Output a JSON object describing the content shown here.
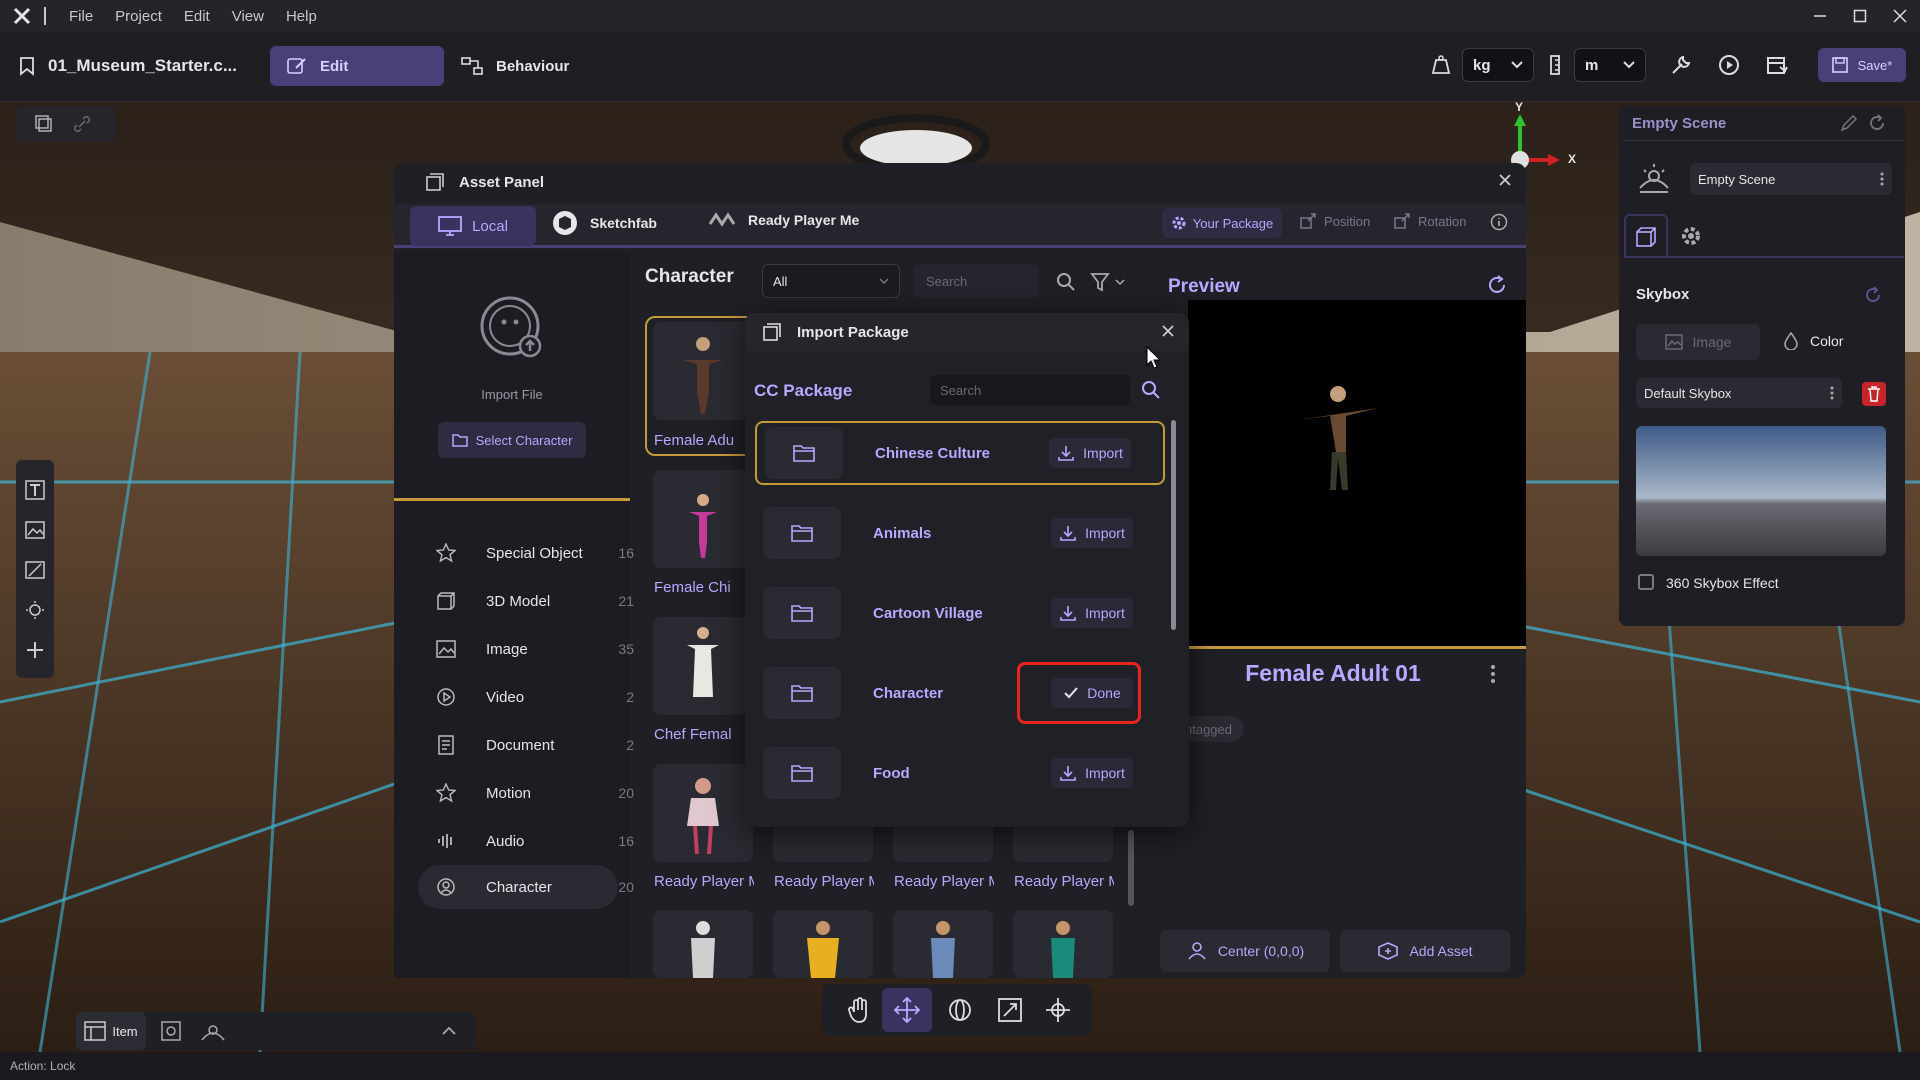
{
  "menubar": {
    "items": [
      "File",
      "Project",
      "Edit",
      "View",
      "Help"
    ]
  },
  "toolbar": {
    "project_name": "01_Museum_Starter.c...",
    "tab_edit": "Edit",
    "tab_behaviour": "Behaviour",
    "unit_mass": "kg",
    "unit_length": "m",
    "save_label": "Save*"
  },
  "asset_panel": {
    "title": "Asset Panel",
    "tabs": [
      "Local",
      "Sketchfab",
      "Ready Player Me"
    ],
    "your_package": "Your Package",
    "position": "Position",
    "rotation": "Rotation",
    "import_file": "Import File",
    "select_character": "Select Character",
    "categories": [
      {
        "label": "Special Object",
        "count": "16"
      },
      {
        "label": "3D Model",
        "count": "21"
      },
      {
        "label": "Image",
        "count": "35"
      },
      {
        "label": "Video",
        "count": "2"
      },
      {
        "label": "Document",
        "count": "2"
      },
      {
        "label": "Motion",
        "count": "20"
      },
      {
        "label": "Audio",
        "count": "16"
      },
      {
        "label": "Character",
        "count": "20"
      }
    ],
    "grid_title": "Character",
    "filter_value": "All",
    "search_placeholder": "Search",
    "thumbs": [
      "Female Adu",
      "Female Chi",
      "Chef Femal",
      "Ready Player M",
      "Ready Player M",
      "Ready Player M",
      "Ready Player M"
    ],
    "preview_title": "Preview",
    "preview_name": "Female Adult 01",
    "preview_tag": "Untagged",
    "center_label": "Center (0,0,0)",
    "add_asset_label": "Add Asset"
  },
  "import_package": {
    "title": "Import Package",
    "section": "CC Package",
    "search_placeholder": "Search",
    "packages": [
      {
        "name": "Chinese Culture",
        "action": "Import"
      },
      {
        "name": "Animals",
        "action": "Import"
      },
      {
        "name": "Cartoon Village",
        "action": "Import"
      },
      {
        "name": "Character",
        "action": "Done"
      },
      {
        "name": "Food",
        "action": "Import"
      }
    ]
  },
  "scene_panel": {
    "title": "Empty Scene",
    "scene_select": "Empty Scene",
    "skybox_title": "Skybox",
    "tab_image": "Image",
    "tab_color": "Color",
    "skybox_select": "Default Skybox",
    "skybox_360": "360 Skybox Effect"
  },
  "gizmo": {
    "y_label": "Y",
    "x_label": "X"
  },
  "bottom_left": {
    "item_label": "Item"
  },
  "status": {
    "text": "Action: Lock"
  },
  "colors": {
    "accent": "#b8a8ff",
    "highlight_border": "#e8241e",
    "edit_tab": "#4a3f78"
  }
}
